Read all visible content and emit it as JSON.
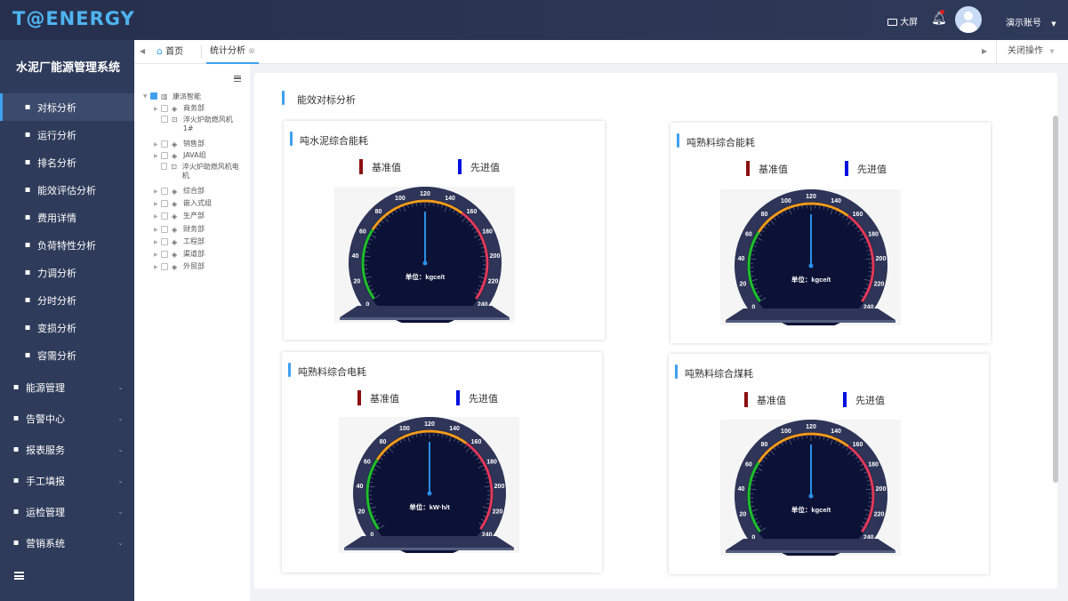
{
  "header": {
    "logo": "T@ENERGY",
    "fullscreen_label": "大屏",
    "account_label": "演示账号"
  },
  "sidebar": {
    "title": "水泥厂能源管理系统",
    "items": [
      {
        "label": "对标分析",
        "icon": "benchmark-icon"
      },
      {
        "label": "运行分析",
        "icon": "run-analysis-icon"
      },
      {
        "label": "排名分析",
        "icon": "ranking-icon"
      },
      {
        "label": "能效评估分析",
        "icon": "efficiency-icon"
      },
      {
        "label": "费用详情",
        "icon": "cost-icon"
      },
      {
        "label": "负荷特性分析",
        "icon": "load-icon"
      },
      {
        "label": "力调分析",
        "icon": "power-factor-icon"
      },
      {
        "label": "分时分析",
        "icon": "time-of-use-icon"
      },
      {
        "label": "变损分析",
        "icon": "transformer-loss-icon"
      },
      {
        "label": "容需分析",
        "icon": "capacity-icon"
      }
    ],
    "groups": [
      {
        "label": "能源管理",
        "icon": "energy-icon"
      },
      {
        "label": "告警中心",
        "icon": "alarm-icon"
      },
      {
        "label": "报表服务",
        "icon": "report-icon"
      },
      {
        "label": "手工填报",
        "icon": "manual-entry-icon"
      },
      {
        "label": "运检管理",
        "icon": "maintenance-icon"
      },
      {
        "label": "营销系统",
        "icon": "marketing-icon"
      }
    ]
  },
  "tabs": {
    "home": "首页",
    "stats": "统计分析",
    "close_ops": "关闭操作"
  },
  "tree": {
    "root": "康派智能",
    "nodes": [
      "商务部",
      "淬火炉助燃风机1#",
      "销售部",
      "JAVA组",
      "淬火炉助燃风机电机",
      "综合部",
      "嵌入式组",
      "生产部",
      "财务部",
      "工程部",
      "渠道部",
      "外贸部"
    ]
  },
  "main": {
    "title": "能效对标分析",
    "legend_baseline": "基准值",
    "legend_advanced": "先进值",
    "colors": {
      "baseline": "#8b1010",
      "advanced": "#0010e0",
      "accent": "#3fa0f0"
    },
    "gauges": [
      {
        "title": "吨水泥综合能耗",
        "unit": "单位：kgce/t",
        "min": 0,
        "max": 240,
        "value": 120
      },
      {
        "title": "吨熟料综合能耗",
        "unit": "单位：kgce/t",
        "min": 0,
        "max": 240,
        "value": 120
      },
      {
        "title": "吨熟料综合电耗",
        "unit": "单位：kW·h/t",
        "min": 0,
        "max": 240,
        "value": 120
      },
      {
        "title": "吨熟料综合煤耗",
        "unit": "单位：kgce/t",
        "min": 0,
        "max": 240,
        "value": 120
      }
    ],
    "ticks": [
      "0",
      "20",
      "40",
      "60",
      "80",
      "100",
      "120",
      "140",
      "160",
      "180",
      "200",
      "220",
      "240"
    ]
  }
}
